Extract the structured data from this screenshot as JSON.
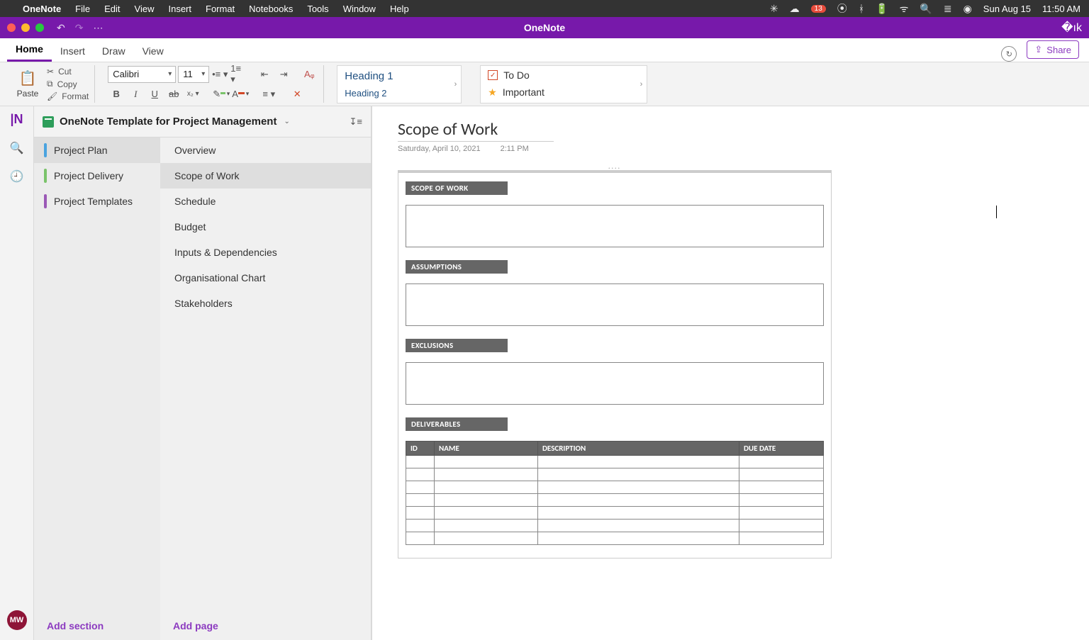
{
  "menubar": {
    "app_name": "OneNote",
    "items": [
      "File",
      "Edit",
      "View",
      "Insert",
      "Format",
      "Notebooks",
      "Tools",
      "Window",
      "Help"
    ],
    "status_badge": "13",
    "date": "Sun Aug 15",
    "time": "11:50 AM"
  },
  "window": {
    "title": "OneNote"
  },
  "ribbon": {
    "tabs": [
      "Home",
      "Insert",
      "Draw",
      "View"
    ],
    "active_tab": "Home",
    "share_label": "Share",
    "paste_label": "Paste",
    "cut_label": "Cut",
    "copy_label": "Copy",
    "format_label": "Format",
    "font_name": "Calibri",
    "font_size": "11",
    "styles": {
      "h1": "Heading 1",
      "h2": "Heading 2"
    },
    "tags": {
      "todo": "To Do",
      "important": "Important"
    }
  },
  "rail": {
    "avatar": "MW"
  },
  "notebook": {
    "name": "OneNote Template for Project Management",
    "sections": [
      {
        "label": "Project Plan",
        "color": "#4aa3df",
        "active": true
      },
      {
        "label": "Project Delivery",
        "color": "#7ac36a",
        "active": false
      },
      {
        "label": "Project Templates",
        "color": "#9b59b6",
        "active": false
      }
    ],
    "pages": [
      {
        "label": "Overview",
        "active": false
      },
      {
        "label": "Scope of Work",
        "active": true
      },
      {
        "label": "Schedule",
        "active": false
      },
      {
        "label": "Budget",
        "active": false
      },
      {
        "label": "Inputs & Dependencies",
        "active": false
      },
      {
        "label": "Organisational Chart",
        "active": false
      },
      {
        "label": "Stakeholders",
        "active": false
      }
    ],
    "add_section": "Add section",
    "add_page": "Add page"
  },
  "page": {
    "title": "Scope of Work",
    "date": "Saturday, April 10, 2021",
    "time": "2:11 PM",
    "sections": {
      "scope": "SCOPE OF WORK",
      "assumptions": "ASSUMPTIONS",
      "exclusions": "EXCLUSIONS",
      "deliverables": "DELIVERABLES"
    },
    "deliverables_cols": [
      "ID",
      "NAME",
      "DESCRIPTION",
      "DUE DATE"
    ],
    "deliverables_rows": 7
  }
}
